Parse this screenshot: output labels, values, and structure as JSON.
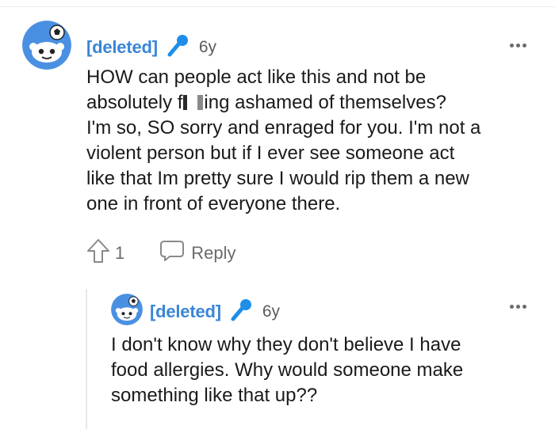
{
  "comments": [
    {
      "username": "[deleted]",
      "age": "6y",
      "text_lines": [
        "HOW can people act like this and not be",
        "absolutely f",
        "ing ashamed of themselves?",
        "I'm so, SO sorry and enraged for you. I'm not a",
        "violent person but if I ever see someone act",
        "like that Im pretty sure I would rip them a new",
        "one in front of everyone there."
      ],
      "upvotes": "1",
      "reply_label": "Reply"
    },
    {
      "username": "[deleted]",
      "age": "6y",
      "text_lines": [
        "I don't know why they don't believe I have",
        "food allergies. Why would someone make",
        "something like that up??"
      ]
    }
  ],
  "colors": {
    "username": "#3a86d6",
    "avatar_bg": "#4a90e2",
    "mic": "#1f8ee8",
    "meta_gray": "#5c5c5c"
  },
  "icons": [
    "snoo-avatar-icon",
    "microphone-icon",
    "more-icon",
    "upvote-icon",
    "reply-bubble-icon"
  ]
}
